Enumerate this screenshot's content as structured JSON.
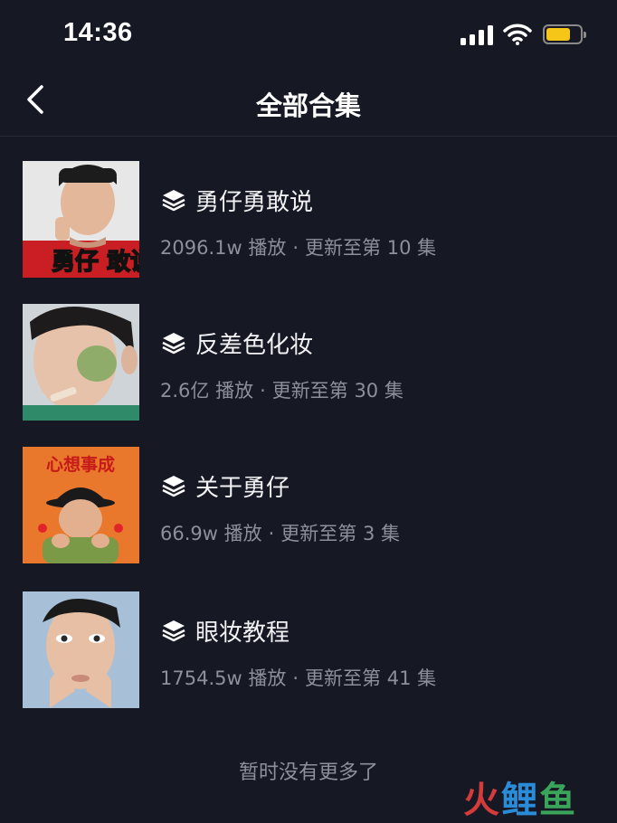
{
  "status_bar": {
    "time": "14:36"
  },
  "nav": {
    "title": "全部合集"
  },
  "collections": [
    {
      "title": "勇仔勇敢说",
      "plays": "2096.1w 播放",
      "update": "更新至第 10 集",
      "thumb_text": "勇仔 敢说"
    },
    {
      "title": "反差色化妆",
      "plays": "2.6亿 播放",
      "update": "更新至第 30 集"
    },
    {
      "title": "关于勇仔",
      "plays": "66.9w 播放",
      "update": "更新至第 3 集",
      "thumb_text": "心想事成"
    },
    {
      "title": "眼妆教程",
      "plays": "1754.5w 播放",
      "update": "更新至第 41 集"
    }
  ],
  "separator": "·",
  "footer": {
    "no_more": "暂时没有更多了"
  },
  "watermark": {
    "char1": "火",
    "char2": "鲤",
    "char3": "鱼"
  },
  "colors": {
    "background": "#161823",
    "secondary_text": "#8d8f99",
    "battery": "#f5c518"
  }
}
